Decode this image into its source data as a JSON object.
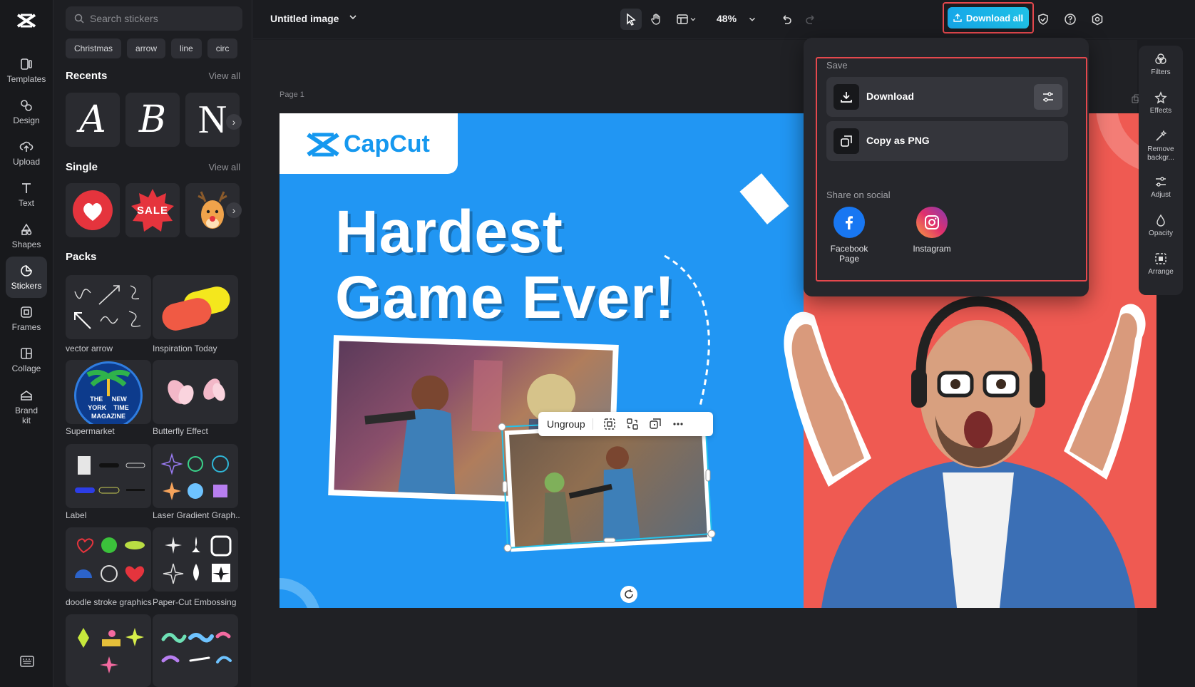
{
  "app": {
    "title": "CapCut"
  },
  "rail": {
    "items": [
      {
        "label": "Templates",
        "icon": "templates-icon"
      },
      {
        "label": "Design",
        "icon": "design-icon"
      },
      {
        "label": "Upload",
        "icon": "upload-icon"
      },
      {
        "label": "Text",
        "icon": "text-icon"
      },
      {
        "label": "Shapes",
        "icon": "shapes-icon"
      },
      {
        "label": "Stickers",
        "icon": "stickers-icon",
        "active": true
      },
      {
        "label": "Frames",
        "icon": "frames-icon"
      },
      {
        "label": "Collage",
        "icon": "collage-icon"
      },
      {
        "label": "Brand kit",
        "icon": "brand-kit-icon"
      }
    ]
  },
  "panel": {
    "search_placeholder": "Search stickers",
    "chips": [
      "Christmas",
      "arrow",
      "line",
      "circ"
    ],
    "recents": {
      "title": "Recents",
      "view_all": "View all",
      "letters": [
        "A",
        "B",
        "N"
      ]
    },
    "single": {
      "title": "Single",
      "view_all": "View all",
      "sale_text": "SALE"
    },
    "packs": {
      "title": "Packs",
      "items": [
        "vector arrow",
        "Inspiration Today",
        "Supermarket",
        "Butterfly Effect",
        "Label",
        "Laser Gradient Graph...",
        "doodle stroke graphics",
        "Paper-Cut Embossing"
      ],
      "magazine_text": [
        "THE",
        "NEW",
        "YORK",
        "TIME",
        "MAGAZINE"
      ]
    }
  },
  "topbar": {
    "doc_title": "Untitled image",
    "zoom": "48%",
    "download_all": "Download all"
  },
  "canvas": {
    "page_label": "Page 1",
    "logo_text": "CapCut",
    "headline_line1": "Hardest",
    "headline_line2": "Game Ever!",
    "context_menu": {
      "ungroup": "Ungroup"
    }
  },
  "right_rail": {
    "items": [
      "Filters",
      "Effects",
      "Remove backgr...",
      "Adjust",
      "Opacity",
      "Arrange"
    ]
  },
  "download_menu": {
    "save_label": "Save",
    "download": "Download",
    "copy_png": "Copy as PNG",
    "share_label": "Share on social",
    "facebook": "Facebook Page",
    "instagram": "Instagram"
  },
  "colors": {
    "accent": "#1fb3ea",
    "canvas_blue": "#2196f3",
    "canvas_red": "#ef5a52",
    "highlight_red": "#e5484d",
    "facebook_blue": "#1877f2"
  }
}
